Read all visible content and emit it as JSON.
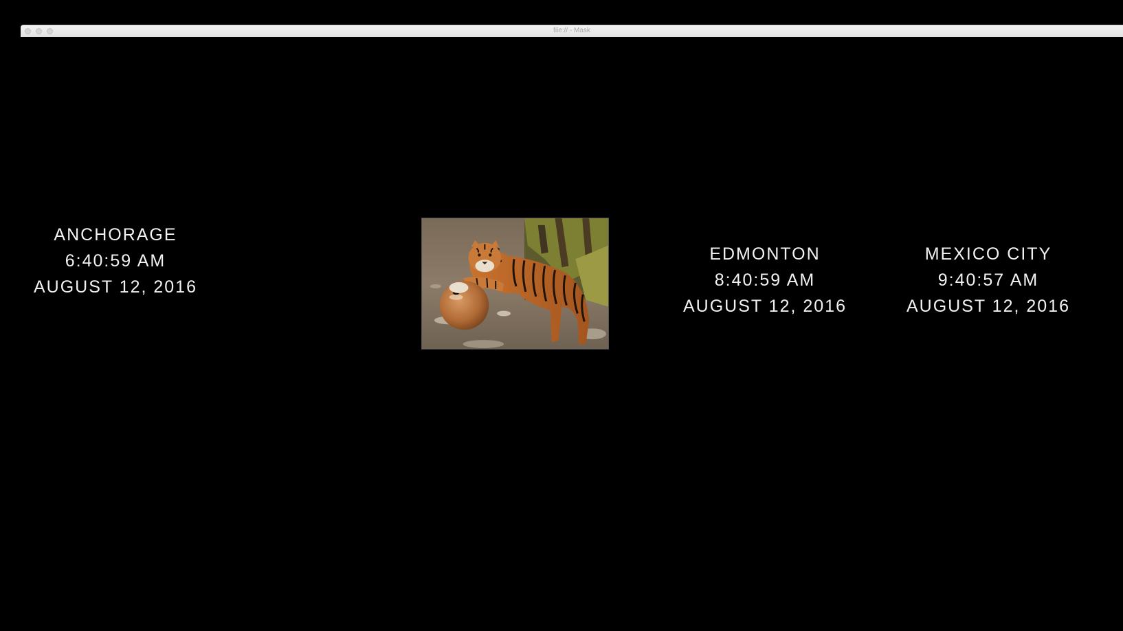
{
  "window": {
    "title": "file:// - Mask"
  },
  "clocks": [
    {
      "city": "ANCHORAGE",
      "time": "6:40:59 AM",
      "date": "AUGUST 12, 2016"
    },
    {
      "city": "EDMONTON",
      "time": "8:40:59 AM",
      "date": "AUGUST 12, 2016"
    },
    {
      "city": "MEXICO CITY",
      "time": "9:40:57 AM",
      "date": "AUGUST 12, 2016"
    }
  ],
  "photo": {
    "subject": "tiger-with-ball"
  },
  "colors": {
    "background": "#000000",
    "text": "#f2f2f2",
    "titlebar": "#ececec"
  }
}
